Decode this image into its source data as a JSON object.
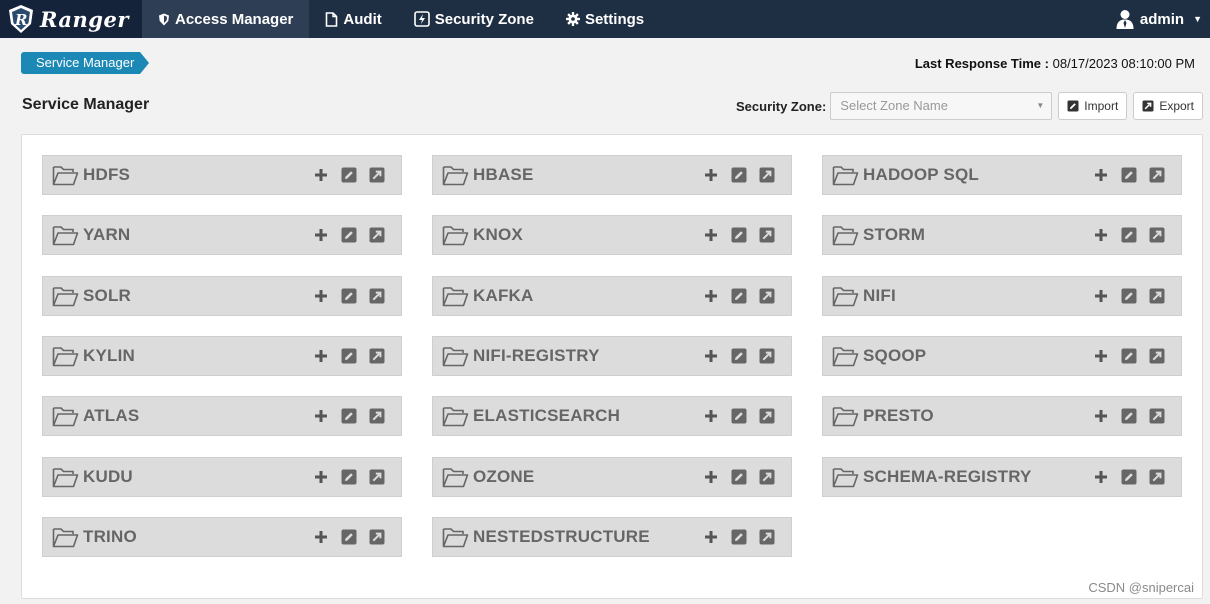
{
  "nav": {
    "brand": "Ranger",
    "items": [
      {
        "label": "Access Manager",
        "icon": "shield-icon",
        "active": true
      },
      {
        "label": "Audit",
        "icon": "file-icon",
        "active": false
      },
      {
        "label": "Security Zone",
        "icon": "bolt-icon",
        "active": false
      },
      {
        "label": "Settings",
        "icon": "gear-icon",
        "active": false
      }
    ],
    "user": "admin"
  },
  "breadcrumb": "Service Manager",
  "last_response": {
    "label": "Last Response Time :",
    "value": "08/17/2023 08:10:00 PM"
  },
  "page_title": "Service Manager",
  "toolbar": {
    "zone_label": "Security Zone:",
    "zone_placeholder": "Select Zone Name",
    "import_label": "Import",
    "export_label": "Export"
  },
  "services": [
    [
      "HDFS",
      "YARN",
      "SOLR",
      "KYLIN",
      "ATLAS",
      "KUDU",
      "TRINO"
    ],
    [
      "HBASE",
      "KNOX",
      "KAFKA",
      "NIFI-REGISTRY",
      "ELASTICSEARCH",
      "OZONE",
      "NESTEDSTRUCTURE"
    ],
    [
      "HADOOP SQL",
      "STORM",
      "NIFI",
      "SQOOP",
      "PRESTO",
      "SCHEMA-REGISTRY"
    ]
  ],
  "watermark": "CSDN @snipercai",
  "colors": {
    "nav_bg": "#1e2e43",
    "breadcrumb_bg": "#1c88b6",
    "service_bg": "#dcdcdc",
    "service_text": "#666666"
  }
}
